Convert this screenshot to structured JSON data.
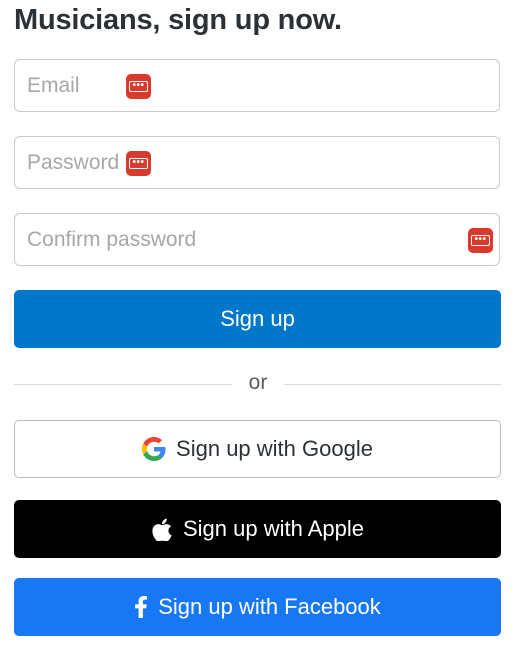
{
  "title": "Musicians, sign up now.",
  "fields": {
    "email_placeholder": "Email",
    "password_placeholder": "Password",
    "confirm_placeholder": "Confirm password"
  },
  "buttons": {
    "signup": "Sign up",
    "google": "Sign up with Google",
    "apple": "Sign up with Apple",
    "facebook": "Sign up with Facebook"
  },
  "divider_text": "or",
  "icons": {
    "password_manager": "password-manager-icon",
    "google": "google-icon",
    "apple": "apple-icon",
    "facebook": "facebook-icon"
  },
  "colors": {
    "primary": "#0077c8",
    "facebook": "#1877f2",
    "apple": "#000000",
    "password_manager": "#d93a2e",
    "title": "#2b3137"
  }
}
